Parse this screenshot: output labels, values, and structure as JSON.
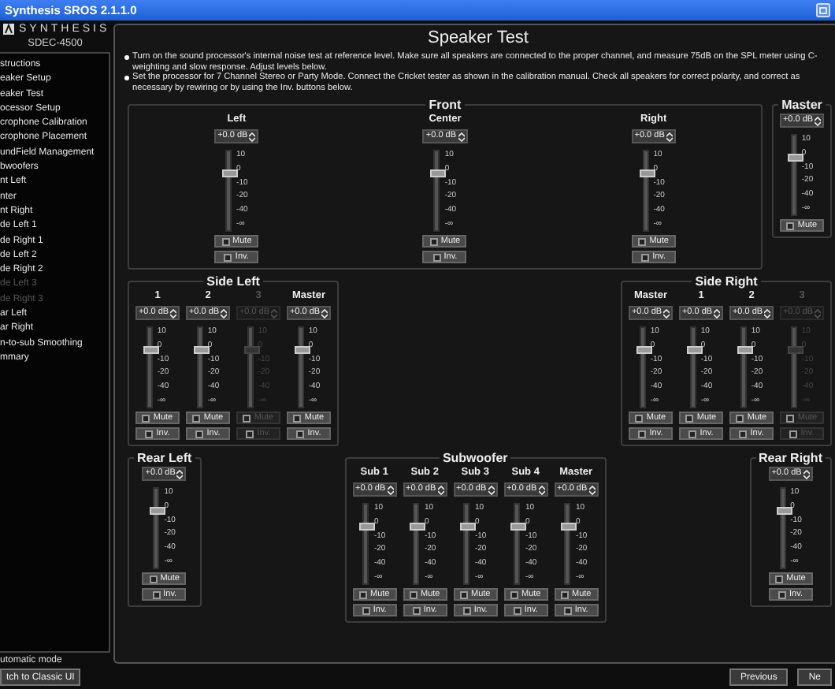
{
  "window": {
    "title": "Synthesis SROS 2.1.1.0"
  },
  "brand": {
    "logo": "SYNTHESIS",
    "model": "SDEC-4500"
  },
  "sidebar": {
    "items": [
      {
        "label": "structions",
        "disabled": false
      },
      {
        "label": "eaker Setup",
        "disabled": false
      },
      {
        "label": "eaker Test",
        "disabled": false
      },
      {
        "label": "ocessor Setup",
        "disabled": false
      },
      {
        "label": "crophone Calibration",
        "disabled": false
      },
      {
        "label": "crophone Placement",
        "disabled": false
      },
      {
        "label": "undField Management",
        "disabled": false
      },
      {
        "label": "bwoofers",
        "disabled": false
      },
      {
        "label": "nt Left",
        "disabled": false
      },
      {
        "label": "nter",
        "disabled": false
      },
      {
        "label": "nt Right",
        "disabled": false
      },
      {
        "label": "de Left 1",
        "disabled": false
      },
      {
        "label": "de Right 1",
        "disabled": false
      },
      {
        "label": "de Left 2",
        "disabled": false
      },
      {
        "label": "de Right 2",
        "disabled": false
      },
      {
        "label": "de Left 3",
        "disabled": true
      },
      {
        "label": "de Right 3",
        "disabled": true
      },
      {
        "label": "ar Left",
        "disabled": false
      },
      {
        "label": "ar Right",
        "disabled": false
      },
      {
        "label": "n-to-sub Smoothing",
        "disabled": false
      },
      {
        "label": "mmary",
        "disabled": false
      }
    ]
  },
  "mode_label": "utomatic mode",
  "switch_button": "tch to Classic UI",
  "page": {
    "title": "Speaker Test",
    "instructions": [
      "Turn on the sound processor's internal noise test at reference level. Make sure all speakers are connected to the proper channel, and measure 75dB on the SPL meter using C-weighting and slow response. Adjust levels below.",
      "Set the processor for 7 Channel Stereo or Party Mode. Connect the Cricket tester as shown in the calibration manual. Check all speakers for correct polarity, and correct as necessary by rewiring or by using the Inv. buttons below."
    ],
    "rows": [
      {
        "groups": [
          {
            "title": "Front",
            "strips": [
              {
                "label": "Left",
                "value": "+0.0 dB",
                "level": 0.72,
                "disabled": false,
                "ticks": [
                  "10",
                  "0",
                  "-10",
                  "-20",
                  "-40",
                  "-∞"
                ],
                "buttons": [
                  {
                    "label": "Mute",
                    "checked": false
                  },
                  {
                    "label": "Inv.",
                    "checked": false
                  }
                ]
              },
              {
                "label": "Center",
                "value": "+0.0 dB",
                "level": 0.72,
                "disabled": false,
                "ticks": [
                  "10",
                  "0",
                  "-10",
                  "-20",
                  "-40",
                  "-∞"
                ],
                "buttons": [
                  {
                    "label": "Mute",
                    "checked": false
                  },
                  {
                    "label": "Inv.",
                    "checked": false
                  }
                ]
              },
              {
                "label": "Right",
                "value": "+0.0 dB",
                "level": 0.72,
                "disabled": false,
                "ticks": [
                  "10",
                  "0",
                  "-10",
                  "-20",
                  "-40",
                  "-∞"
                ],
                "buttons": [
                  {
                    "label": "Mute",
                    "checked": false
                  },
                  {
                    "label": "Inv.",
                    "checked": false
                  }
                ]
              }
            ]
          },
          {
            "title": "Master",
            "strips": [
              {
                "value": "+0.0 dB",
                "level": 0.72,
                "disabled": false,
                "ticks": [
                  "10",
                  "0",
                  "-10",
                  "-20",
                  "-40",
                  "-∞"
                ],
                "buttons": [
                  {
                    "label": "Mute",
                    "checked": false
                  }
                ]
              }
            ]
          }
        ]
      },
      {
        "groups": [
          {
            "title": "Side Left",
            "strips": [
              {
                "label": "1",
                "value": "+0.0 dB",
                "level": 0.72,
                "disabled": false,
                "ticks": [
                  "10",
                  "0",
                  "-10",
                  "-20",
                  "-40",
                  "-∞"
                ],
                "buttons": [
                  {
                    "label": "Mute",
                    "checked": false
                  },
                  {
                    "label": "Inv.",
                    "checked": false
                  }
                ]
              },
              {
                "label": "2",
                "value": "+0.0 dB",
                "level": 0.72,
                "disabled": false,
                "ticks": [
                  "10",
                  "0",
                  "-10",
                  "-20",
                  "-40",
                  "-∞"
                ],
                "buttons": [
                  {
                    "label": "Mute",
                    "checked": false
                  },
                  {
                    "label": "Inv.",
                    "checked": false
                  }
                ]
              },
              {
                "label": "3",
                "value": "+0.0 dB",
                "level": 0.72,
                "disabled": true,
                "ticks": [
                  "10",
                  "0",
                  "-10",
                  "-20",
                  "-40",
                  "-∞"
                ],
                "buttons": [
                  {
                    "label": "Mute",
                    "checked": false
                  },
                  {
                    "label": "Inv.",
                    "checked": false
                  }
                ]
              },
              {
                "label": "Master",
                "value": "+0.0 dB",
                "level": 0.72,
                "disabled": false,
                "ticks": [
                  "10",
                  "0",
                  "-10",
                  "-20",
                  "-40",
                  "-∞"
                ],
                "buttons": [
                  {
                    "label": "Mute",
                    "checked": false
                  },
                  {
                    "label": "Inv.",
                    "checked": false
                  }
                ]
              }
            ]
          },
          {
            "title": "Side Right",
            "strips": [
              {
                "label": "Master",
                "value": "+0.0 dB",
                "level": 0.72,
                "disabled": false,
                "ticks": [
                  "10",
                  "0",
                  "-10",
                  "-20",
                  "-40",
                  "-∞"
                ],
                "buttons": [
                  {
                    "label": "Mute",
                    "checked": false
                  },
                  {
                    "label": "Inv.",
                    "checked": false
                  }
                ]
              },
              {
                "label": "1",
                "value": "+0.0 dB",
                "level": 0.72,
                "disabled": false,
                "ticks": [
                  "10",
                  "0",
                  "-10",
                  "-20",
                  "-40",
                  "-∞"
                ],
                "buttons": [
                  {
                    "label": "Mute",
                    "checked": false
                  },
                  {
                    "label": "Inv.",
                    "checked": false
                  }
                ]
              },
              {
                "label": "2",
                "value": "+0.0 dB",
                "level": 0.72,
                "disabled": false,
                "ticks": [
                  "10",
                  "0",
                  "-10",
                  "-20",
                  "-40",
                  "-∞"
                ],
                "buttons": [
                  {
                    "label": "Mute",
                    "checked": false
                  },
                  {
                    "label": "Inv.",
                    "checked": false
                  }
                ]
              },
              {
                "label": "3",
                "value": "+0.0 dB",
                "level": 0.72,
                "disabled": true,
                "ticks": [
                  "10",
                  "0",
                  "-10",
                  "-20",
                  "-40",
                  "-∞"
                ],
                "buttons": [
                  {
                    "label": "Mute",
                    "checked": false
                  },
                  {
                    "label": "Inv.",
                    "checked": false
                  }
                ]
              }
            ]
          }
        ]
      },
      {
        "groups": [
          {
            "title": "Rear Left",
            "strips": [
              {
                "value": "+0.0 dB",
                "level": 0.72,
                "disabled": false,
                "ticks": [
                  "10",
                  "0",
                  "-10",
                  "-20",
                  "-40",
                  "-∞"
                ],
                "buttons": [
                  {
                    "label": "Mute",
                    "checked": false
                  },
                  {
                    "label": "Inv.",
                    "checked": false
                  }
                ]
              }
            ]
          },
          {
            "title": "Subwoofer",
            "strips": [
              {
                "label": "Sub 1",
                "value": "+0.0 dB",
                "level": 0.72,
                "disabled": false,
                "ticks": [
                  "10",
                  "0",
                  "-10",
                  "-20",
                  "-40",
                  "-∞"
                ],
                "buttons": [
                  {
                    "label": "Mute",
                    "checked": false
                  },
                  {
                    "label": "Inv.",
                    "checked": false
                  }
                ]
              },
              {
                "label": "Sub 2",
                "value": "+0.0 dB",
                "level": 0.72,
                "disabled": false,
                "ticks": [
                  "10",
                  "0",
                  "-10",
                  "-20",
                  "-40",
                  "-∞"
                ],
                "buttons": [
                  {
                    "label": "Mute",
                    "checked": false
                  },
                  {
                    "label": "Inv.",
                    "checked": false
                  }
                ]
              },
              {
                "label": "Sub 3",
                "value": "+0.0 dB",
                "level": 0.72,
                "disabled": false,
                "ticks": [
                  "10",
                  "0",
                  "-10",
                  "-20",
                  "-40",
                  "-∞"
                ],
                "buttons": [
                  {
                    "label": "Mute",
                    "checked": false
                  },
                  {
                    "label": "Inv.",
                    "checked": false
                  }
                ]
              },
              {
                "label": "Sub 4",
                "value": "+0.0 dB",
                "level": 0.72,
                "disabled": false,
                "ticks": [
                  "10",
                  "0",
                  "-10",
                  "-20",
                  "-40",
                  "-∞"
                ],
                "buttons": [
                  {
                    "label": "Mute",
                    "checked": false
                  },
                  {
                    "label": "Inv.",
                    "checked": false
                  }
                ]
              },
              {
                "label": "Master",
                "value": "+0.0 dB",
                "level": 0.72,
                "disabled": false,
                "ticks": [
                  "10",
                  "0",
                  "-10",
                  "-20",
                  "-40",
                  "-∞"
                ],
                "buttons": [
                  {
                    "label": "Mute",
                    "checked": false
                  },
                  {
                    "label": "Inv.",
                    "checked": false
                  }
                ]
              }
            ]
          },
          {
            "title": "Rear Right",
            "strips": [
              {
                "value": "+0.0 dB",
                "level": 0.72,
                "disabled": false,
                "ticks": [
                  "10",
                  "0",
                  "-10",
                  "-20",
                  "-40",
                  "-∞"
                ],
                "buttons": [
                  {
                    "label": "Mute",
                    "checked": false
                  },
                  {
                    "label": "Inv.",
                    "checked": false
                  }
                ]
              }
            ]
          }
        ]
      }
    ]
  },
  "nav_buttons": [
    "Previous",
    "Ne"
  ]
}
